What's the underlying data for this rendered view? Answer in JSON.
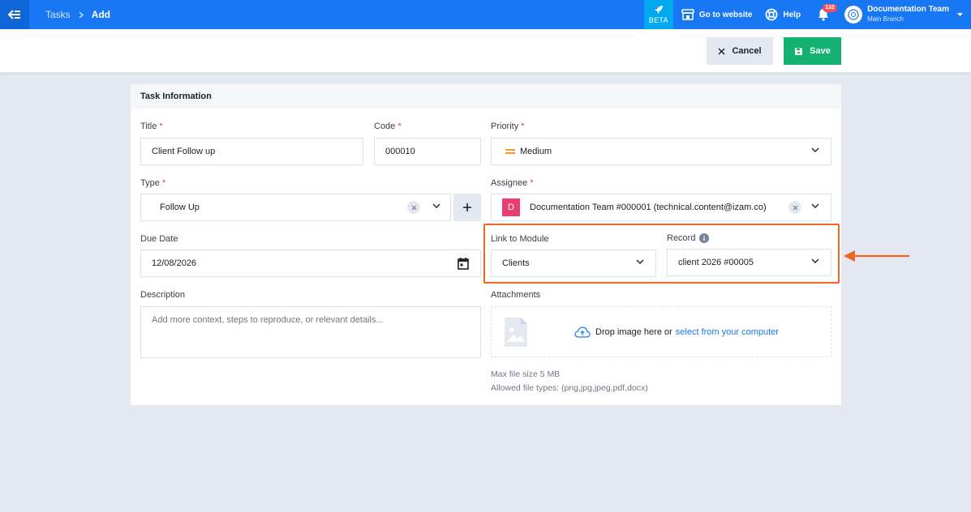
{
  "topbar": {
    "breadcrumb_tasks": "Tasks",
    "breadcrumb_current": "Add",
    "beta_label": "BETA",
    "goto_website": "Go to website",
    "help": "Help",
    "notification_count": "132",
    "account_name": "Documentation Team",
    "account_branch": "Main Branch"
  },
  "actions": {
    "cancel": "Cancel",
    "save": "Save"
  },
  "panel": {
    "title": "Task Information"
  },
  "form": {
    "title_label": "Title",
    "title_value": "Client Follow up",
    "code_label": "Code",
    "code_value": "000010",
    "priority_label": "Priority",
    "priority_value": "Medium",
    "type_label": "Type",
    "type_value": "Follow Up",
    "assignee_label": "Assignee",
    "assignee_avatar": "D",
    "assignee_value": "Documentation Team #000001 (technical.content@izam.co)",
    "due_label": "Due Date",
    "due_value": "12/08/2026",
    "link_label": "Link to Module",
    "link_value": "Clients",
    "record_label": "Record",
    "record_value": "client 2026 #00005",
    "desc_label": "Description",
    "desc_placeholder": "Add more context, steps to reproduce, or relevant details...",
    "attach_label": "Attachments",
    "drop_text": "Drop image here or",
    "drop_link": "select from your computer",
    "max_size": "Max file size 5 MB",
    "allowed_types": "Allowed file types: (png,jpg,jpeg,pdf,docx)",
    "required_mark": "*"
  },
  "colors": {
    "brand": "#1877f2",
    "save": "#13b272",
    "highlight": "#f26522",
    "required": "#e5384e",
    "priority_medium": "#f29a2e"
  }
}
